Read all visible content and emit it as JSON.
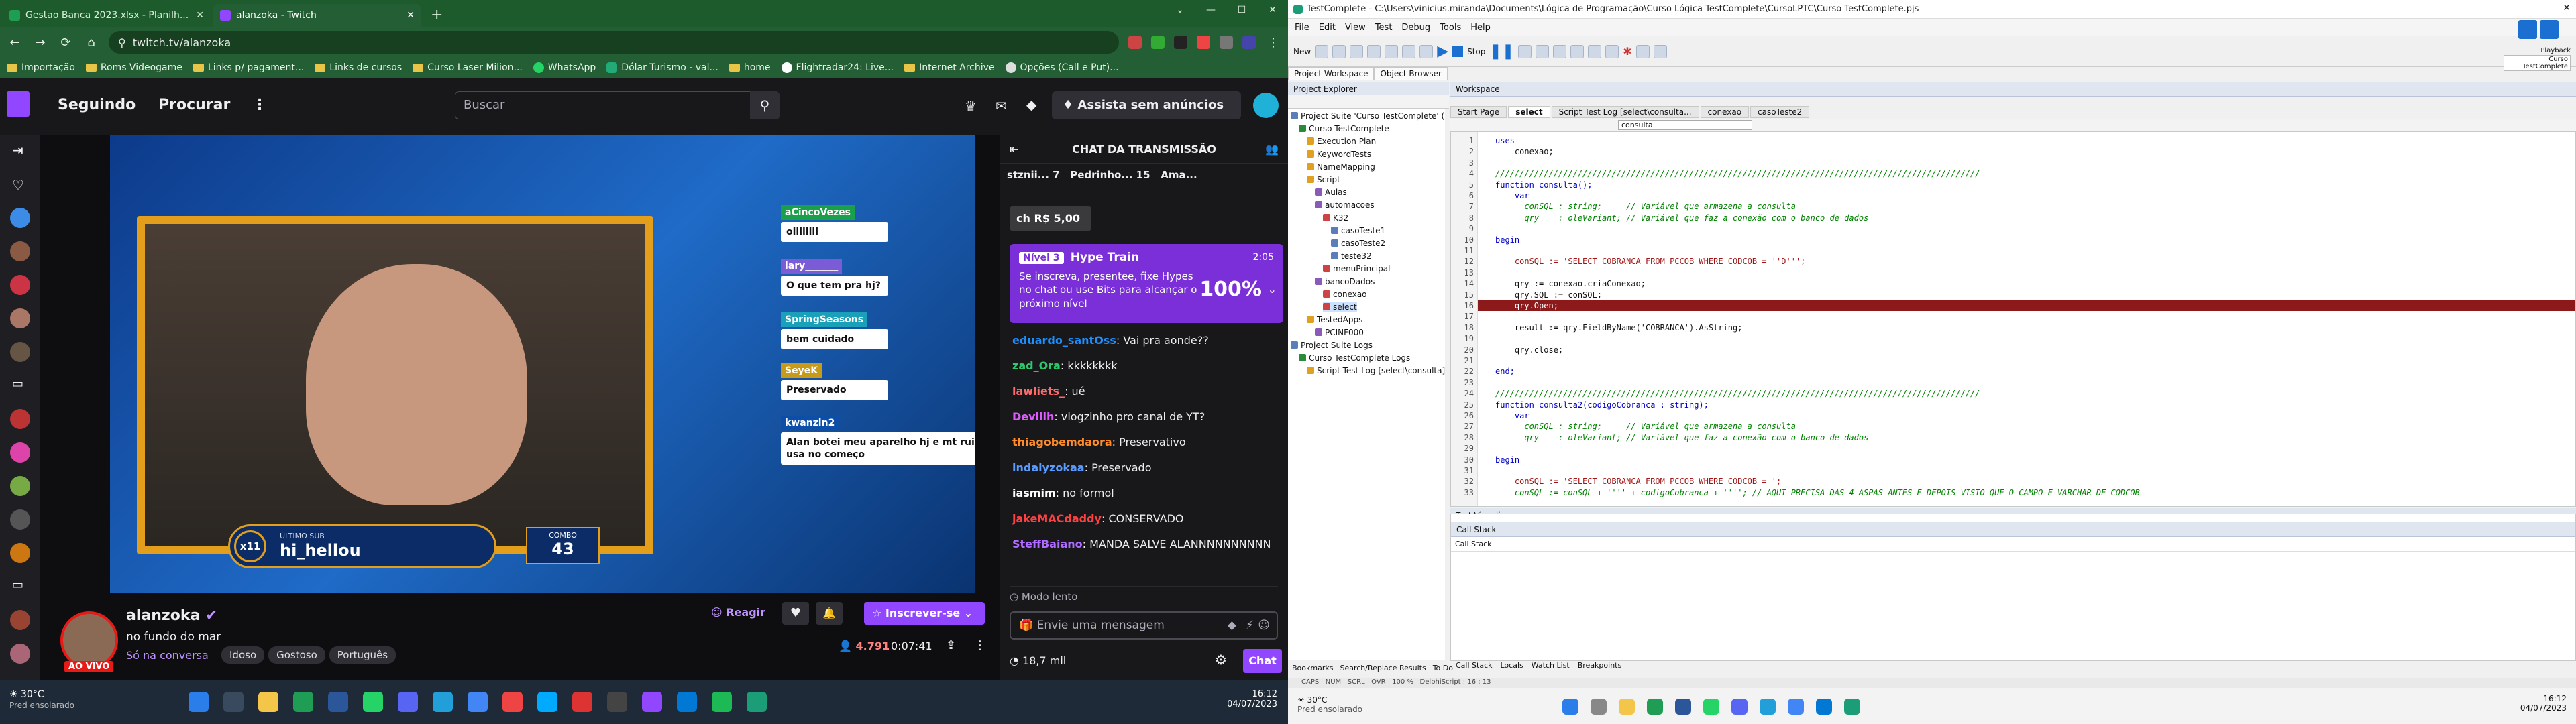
{
  "colors": {
    "twitch_purple": "#9146ff",
    "chrome_green": "#235e34",
    "hype_purple": "#7b2fd8",
    "live_red": "#e91916",
    "breakpoint_red": "#8c1a1a"
  },
  "browser": {
    "tabs": [
      {
        "label": "Gestao Banca 2023.xlsx - Planilh..."
      },
      {
        "label": "alanzoka - Twitch"
      }
    ],
    "url": "twitch.tv/alanzoka",
    "bookmarks": [
      "Importação",
      "Roms Videogame",
      "Links p/ pagament...",
      "Links de cursos",
      "Curso Laser Milion...",
      "WhatsApp",
      "Dólar Turismo - val...",
      "home",
      "Flightradar24: Live...",
      "Internet Archive",
      "Opções (Call e Put)..."
    ]
  },
  "twitch": {
    "nav": {
      "following": "Seguindo",
      "browse": "Procurar",
      "more": "⋮"
    },
    "search_placeholder": "Buscar",
    "prime_label": "Assista sem anúncios",
    "stream": {
      "overlay_chat": [
        {
          "name": "aCincoVezes",
          "msg": "oiiiiiiii"
        },
        {
          "name": "lary_______",
          "msg": "O que tem pra hj?"
        },
        {
          "name": "SpringSeasons",
          "msg": "bem cuidado"
        },
        {
          "name": "SeyeK",
          "msg": "Preservado"
        },
        {
          "name": "kwanzin2",
          "msg": "Alan botei meu aparelho hj e mt ruim usa no começo"
        }
      ],
      "last_sub_label": "ÚLTIMO SUB",
      "last_sub_name": "hi_hellou",
      "last_sub_badge": "x11",
      "combo_label": "COMBO",
      "combo_value": "43"
    },
    "channel": {
      "name": "alanzoka",
      "title": "no fundo do mar",
      "category": "Só na conversa",
      "tags": [
        "Idoso",
        "Gostoso",
        "Português"
      ],
      "live": "AO VIVO",
      "react": "Reagir",
      "subscribe": "Inscrever-se",
      "viewers": "4.791",
      "uptime": "0:07:41"
    },
    "chat": {
      "header": "CHAT DA TRANSMISSÃO",
      "top_gifters": [
        {
          "name": "stznii...",
          "count": "7"
        },
        {
          "name": "Pedrinho...",
          "count": "15"
        },
        {
          "name": "Ama...",
          "count": ""
        }
      ],
      "pinned_amount": "R$ 5,00",
      "hype": {
        "level": "Nível 3",
        "title": "Hype Train",
        "timer": "2:05",
        "text": "Se inscreva, presentee, fixe Hypes no chat ou use Bits para alcançar o próximo nível",
        "percent": "100%"
      },
      "messages": [
        {
          "user": "eduardo_santOss",
          "text": "Vai pra aonde??",
          "color": "#1e90ff"
        },
        {
          "user": "zad_Ora",
          "text": "kkkkkkkk",
          "color": "#2dc96b"
        },
        {
          "user": "lawliets_",
          "text": "ué",
          "color": "#ff6b6b"
        },
        {
          "user": "Devilih",
          "text": "vlogzinho pro canal de YT?",
          "color": "#e05bff"
        },
        {
          "user": "thiagobemdaora",
          "text": "Preservativo",
          "color": "#ff8c2b"
        },
        {
          "user": "indalyzokaa",
          "text": "Preservado",
          "color": "#5a9bff"
        },
        {
          "user": "iasmim",
          "text": "no formol",
          "color": "#ffffff"
        },
        {
          "user": "jakeMACdaddy",
          "text": "CONSERVADO",
          "color": "#ff4040"
        },
        {
          "user": "SteffBaiano",
          "text": "MANDA SALVE ALANNNNNNNNNN",
          "color": "#b06bff"
        }
      ],
      "slow_mode": "Modo lento",
      "input_placeholder": "Envie uma mensagem",
      "points": "18,7 mil",
      "chat_button": "Chat"
    }
  },
  "taskbar_left": {
    "weather_temp": "30°C",
    "weather_text": "Pred ensolarado",
    "time": "16:12",
    "date": "04/07/2023"
  },
  "ide": {
    "title": "TestComplete - C:\\Users\\vinicius.miranda\\Documents\\Lógica de Programação\\Curso Lógica TestComplete\\CursoLPTC\\Curso TestComplete.pjs",
    "menu": [
      "File",
      "Edit",
      "View",
      "Test",
      "Debug",
      "Tools",
      "Help"
    ],
    "new_label": "New",
    "stop_label": "Stop",
    "playback_label": "Playback",
    "playback_sub": "Curso TestComplete",
    "panel_tabs": [
      "Project Workspace",
      "Object Browser"
    ],
    "explorer_title": "Project Explorer",
    "workspace_title": "Workspace",
    "tree": [
      {
        "label": "Project Suite 'Curso TestComplete' (1 pro...",
        "indent": 0
      },
      {
        "label": "Curso TestComplete",
        "indent": 1
      },
      {
        "label": "Execution Plan",
        "indent": 2
      },
      {
        "label": "KeywordTests",
        "indent": 2
      },
      {
        "label": "NameMapping",
        "indent": 2
      },
      {
        "label": "Script",
        "indent": 2
      },
      {
        "label": "Aulas",
        "indent": 3
      },
      {
        "label": "automacoes",
        "indent": 3
      },
      {
        "label": "K32",
        "indent": 4
      },
      {
        "label": "casoTeste1",
        "indent": 5
      },
      {
        "label": "casoTeste2",
        "indent": 5
      },
      {
        "label": "teste32",
        "indent": 5
      },
      {
        "label": "menuPrincipal",
        "indent": 4
      },
      {
        "label": "bancoDados",
        "indent": 3
      },
      {
        "label": "conexao",
        "indent": 4
      },
      {
        "label": "select",
        "indent": 4
      },
      {
        "label": "TestedApps",
        "indent": 2
      },
      {
        "label": "PCINF000",
        "indent": 3
      },
      {
        "label": "Project Suite Logs",
        "indent": 0
      },
      {
        "label": "Curso TestComplete Logs",
        "indent": 1
      },
      {
        "label": "Script Test Log [select\\consulta]...",
        "indent": 2
      }
    ],
    "editor_tabs": [
      "Start Page",
      "select",
      "Script Test Log [select\\consulta...",
      "conexao",
      "casoTeste2"
    ],
    "routine_combo": "consulta",
    "code": [
      {
        "n": "1",
        "t": "uses",
        "k": "kw"
      },
      {
        "n": "2",
        "t": "    conexao;",
        "k": ""
      },
      {
        "n": "3",
        "t": "",
        "k": ""
      },
      {
        "n": "4",
        "t": "////////////////////////////////////////////////////////////////////////////////////////////////////",
        "k": "cm"
      },
      {
        "n": "5",
        "t": "function consulta();",
        "k": "kw"
      },
      {
        "n": "6",
        "t": "    var",
        "k": "kw"
      },
      {
        "n": "7",
        "t": "      conSQL : string;     // Variável que armazena a consulta",
        "k": "cm"
      },
      {
        "n": "8",
        "t": "      qry    : oleVariant; // Variável que faz a conexão com o banco de dados",
        "k": "cm"
      },
      {
        "n": "9",
        "t": "",
        "k": ""
      },
      {
        "n": "10",
        "t": "begin",
        "k": "kw"
      },
      {
        "n": "11",
        "t": "",
        "k": ""
      },
      {
        "n": "12",
        "t": "    conSQL := 'SELECT COBRANCA FROM PCCOB WHERE CODCOB = ''D''';",
        "k": "st"
      },
      {
        "n": "13",
        "t": "",
        "k": ""
      },
      {
        "n": "14",
        "t": "    qry := conexao.criaConexao;",
        "k": ""
      },
      {
        "n": "15",
        "t": "    qry.SQL := conSQL;",
        "k": ""
      },
      {
        "n": "16",
        "t": "    qry.Open;",
        "k": "hl"
      },
      {
        "n": "17",
        "t": "",
        "k": ""
      },
      {
        "n": "18",
        "t": "    result := qry.FieldByName('COBRANCA').AsString;",
        "k": ""
      },
      {
        "n": "19",
        "t": "",
        "k": ""
      },
      {
        "n": "20",
        "t": "    qry.close;",
        "k": ""
      },
      {
        "n": "21",
        "t": "",
        "k": ""
      },
      {
        "n": "22",
        "t": "end;",
        "k": "kw"
      },
      {
        "n": "23",
        "t": "",
        "k": ""
      },
      {
        "n": "24",
        "t": "////////////////////////////////////////////////////////////////////////////////////////////////////",
        "k": "cm"
      },
      {
        "n": "25",
        "t": "function consulta2(codigoCobranca : string);",
        "k": "kw"
      },
      {
        "n": "26",
        "t": "    var",
        "k": "kw"
      },
      {
        "n": "27",
        "t": "      conSQL : string;     // Variável que armazena a consulta",
        "k": "cm"
      },
      {
        "n": "28",
        "t": "      qry    : oleVariant; // Variável que faz a conexão com o banco de dados",
        "k": "cm"
      },
      {
        "n": "29",
        "t": "",
        "k": ""
      },
      {
        "n": "30",
        "t": "begin",
        "k": "kw"
      },
      {
        "n": "31",
        "t": "",
        "k": ""
      },
      {
        "n": "32",
        "t": "    conSQL := 'SELECT COBRANCA FROM PCCOB WHERE CODCOB = ';",
        "k": "st"
      },
      {
        "n": "33",
        "t": "    conSQL := conSQL + '''' + codigoCobranca + ''''; // AQUI PRECISA DAS 4 ASPAS ANTES E DEPOIS VISTO QUE O CAMPO E VARCHAR DE CODCOB",
        "k": "cm"
      }
    ],
    "test_visualizer": "Test Visualizer",
    "call_stack_title": "Call Stack",
    "call_stack_header": "Call Stack",
    "bottom_tabs": [
      "Call Stack",
      "Locals",
      "Watch List",
      "Breakpoints"
    ],
    "left_bottom_tabs": [
      "Bookmarks",
      "Search/Replace Results",
      "To Do"
    ],
    "status": [
      "CAPS",
      "NUM",
      "SCRL",
      "OVR",
      "100 %",
      "DelphiScript : 16 : 13"
    ],
    "taskbar": {
      "weather_temp": "30°C",
      "weather_text": "Pred ensolarado",
      "time": "16:12",
      "date": "04/07/2023"
    }
  }
}
